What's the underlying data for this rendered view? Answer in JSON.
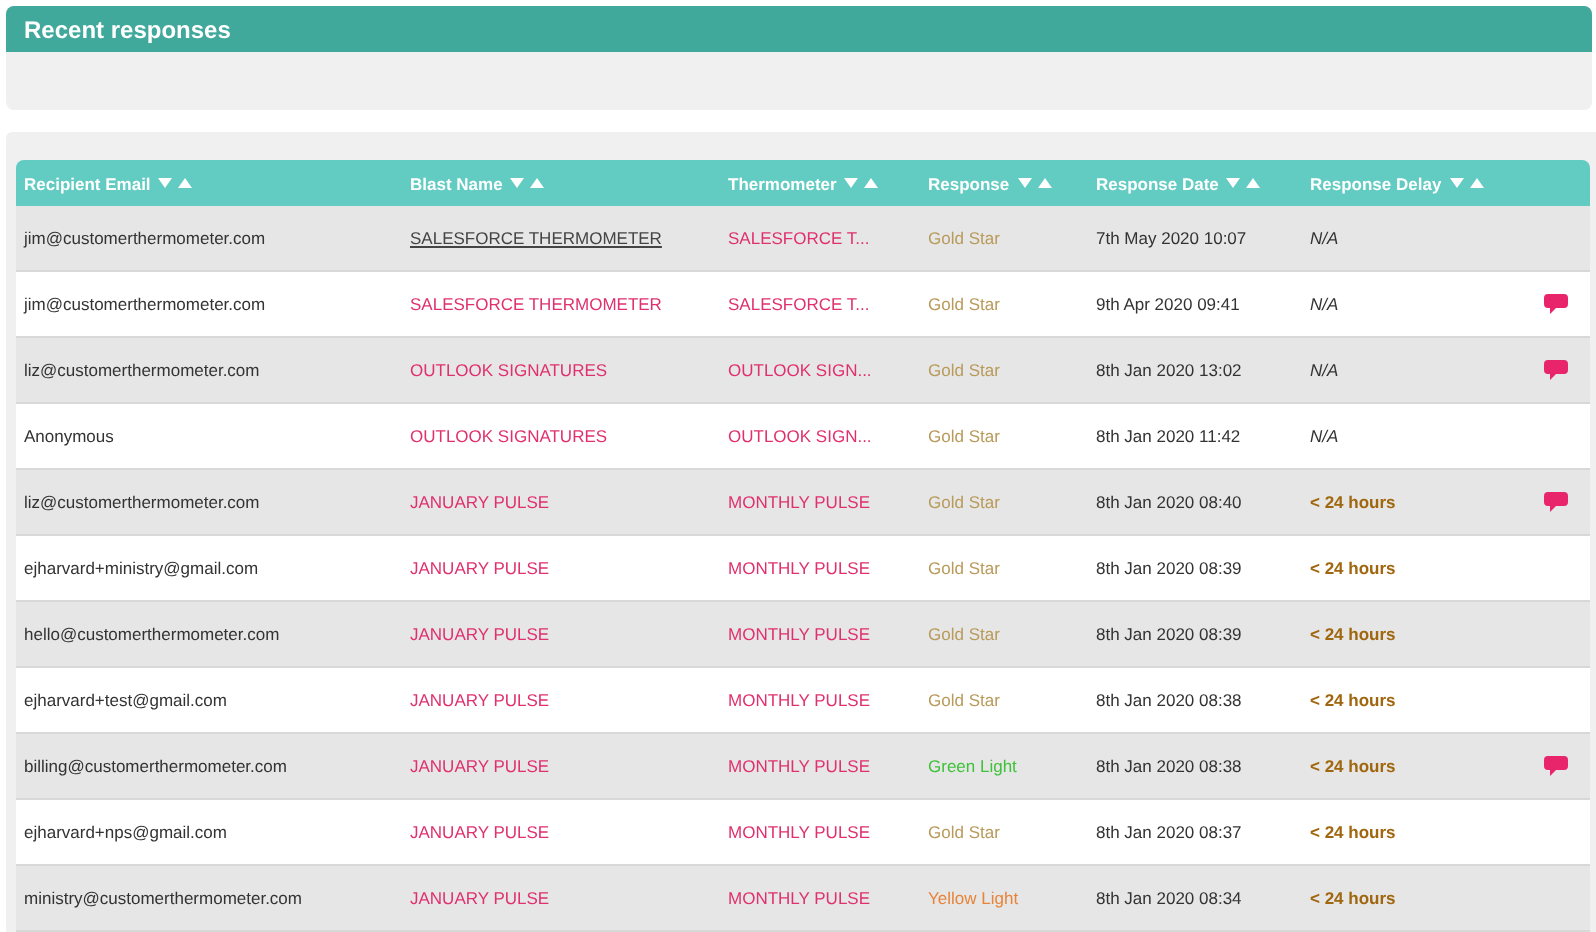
{
  "panel": {
    "title": "Recent responses"
  },
  "table": {
    "columns": [
      {
        "label": "Recipient Email"
      },
      {
        "label": "Blast Name"
      },
      {
        "label": "Thermometer"
      },
      {
        "label": "Response"
      },
      {
        "label": "Response Date"
      },
      {
        "label": "Response Delay"
      }
    ],
    "rows": [
      {
        "email": "jim@customerthermometer.com",
        "blast": "SALESFORCE THERMOMETER",
        "hovered": true,
        "thermometer": "SALESFORCE T...",
        "response": "Gold Star",
        "color": "#b89a5a",
        "date": "7th May 2020 10:07",
        "delay": {
          "text": "N/A",
          "kind": "na"
        },
        "has_comment": false
      },
      {
        "email": "jim@customerthermometer.com",
        "blast": "SALESFORCE THERMOMETER",
        "hovered": false,
        "thermometer": "SALESFORCE T...",
        "response": "Gold Star",
        "color": "#b89a5a",
        "date": "9th Apr 2020 09:41",
        "delay": {
          "text": "N/A",
          "kind": "na"
        },
        "has_comment": true
      },
      {
        "email": "liz@customerthermometer.com",
        "blast": "OUTLOOK SIGNATURES",
        "hovered": false,
        "thermometer": "OUTLOOK SIGN...",
        "response": "Gold Star",
        "color": "#b89a5a",
        "date": "8th Jan 2020 13:02",
        "delay": {
          "text": "N/A",
          "kind": "na"
        },
        "has_comment": true
      },
      {
        "email": "Anonymous",
        "blast": "OUTLOOK SIGNATURES",
        "hovered": false,
        "thermometer": "OUTLOOK SIGN...",
        "response": "Gold Star",
        "color": "#b89a5a",
        "date": "8th Jan 2020 11:42",
        "delay": {
          "text": "N/A",
          "kind": "na"
        },
        "has_comment": false
      },
      {
        "email": "liz@customerthermometer.com",
        "blast": "JANUARY PULSE",
        "hovered": false,
        "thermometer": "MONTHLY PULSE",
        "response": "Gold Star",
        "color": "#b89a5a",
        "date": "8th Jan 2020 08:40",
        "delay": {
          "text": "< 24 hours",
          "kind": "hours"
        },
        "has_comment": true
      },
      {
        "email": "ejharvard+ministry@gmail.com",
        "blast": "JANUARY PULSE",
        "hovered": false,
        "thermometer": "MONTHLY PULSE",
        "response": "Gold Star",
        "color": "#b89a5a",
        "date": "8th Jan 2020 08:39",
        "delay": {
          "text": "< 24 hours",
          "kind": "hours"
        },
        "has_comment": false
      },
      {
        "email": "hello@customerthermometer.com",
        "blast": "JANUARY PULSE",
        "hovered": false,
        "thermometer": "MONTHLY PULSE",
        "response": "Gold Star",
        "color": "#b89a5a",
        "date": "8th Jan 2020 08:39",
        "delay": {
          "text": "< 24 hours",
          "kind": "hours"
        },
        "has_comment": false
      },
      {
        "email": "ejharvard+test@gmail.com",
        "blast": "JANUARY PULSE",
        "hovered": false,
        "thermometer": "MONTHLY PULSE",
        "response": "Gold Star",
        "color": "#b89a5a",
        "date": "8th Jan 2020 08:38",
        "delay": {
          "text": "< 24 hours",
          "kind": "hours"
        },
        "has_comment": false
      },
      {
        "email": "billing@customerthermometer.com",
        "blast": "JANUARY PULSE",
        "hovered": false,
        "thermometer": "MONTHLY PULSE",
        "response": "Green Light",
        "color": "#3fc23a",
        "date": "8th Jan 2020 08:38",
        "delay": {
          "text": "< 24 hours",
          "kind": "hours"
        },
        "has_comment": true
      },
      {
        "email": "ejharvard+nps@gmail.com",
        "blast": "JANUARY PULSE",
        "hovered": false,
        "thermometer": "MONTHLY PULSE",
        "response": "Gold Star",
        "color": "#b89a5a",
        "date": "8th Jan 2020 08:37",
        "delay": {
          "text": "< 24 hours",
          "kind": "hours"
        },
        "has_comment": false
      },
      {
        "email": "ministry@customerthermometer.com",
        "blast": "JANUARY PULSE",
        "hovered": false,
        "thermometer": "MONTHLY PULSE",
        "response": "Yellow Light",
        "color": "#e8843a",
        "date": "8th Jan 2020 08:34",
        "delay": {
          "text": "< 24 hours",
          "kind": "hours"
        },
        "has_comment": false
      }
    ]
  }
}
